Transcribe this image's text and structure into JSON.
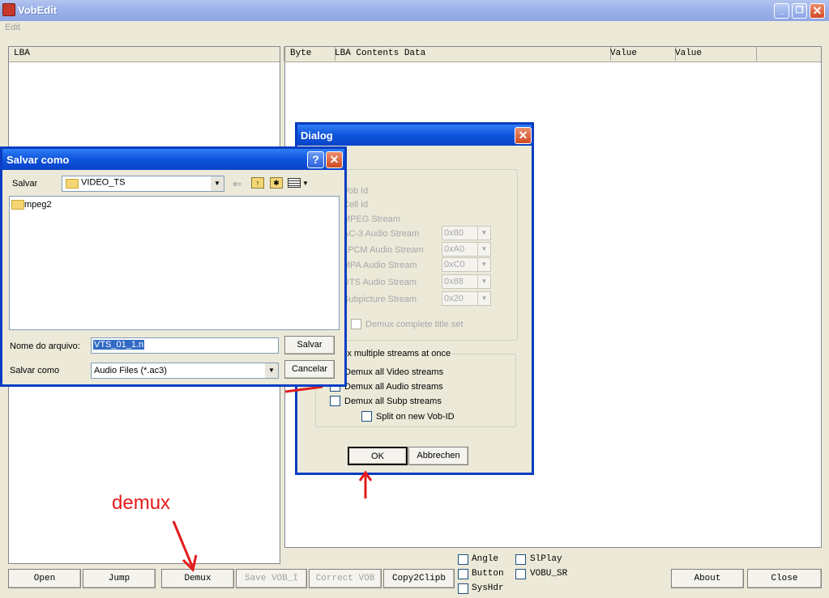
{
  "window": {
    "title": "VobEdit",
    "menu": [
      "Edit"
    ]
  },
  "left_pane": {
    "header": "LBA"
  },
  "right_pane": {
    "headers": [
      "Byte",
      "LBA Contents Data",
      "Value",
      "Value"
    ]
  },
  "bottom_buttons": {
    "open": "Open",
    "jump": "Jump",
    "demux": "Demux",
    "save_vob": "Save VOB_I",
    "correct_vob": "Correct VOB",
    "copy2clipb": "Copy2Clipb",
    "about": "About",
    "close": "Close"
  },
  "checkboxes": {
    "angle": "Angle",
    "button": "Button",
    "syshdr": "SysHdr",
    "slplay": "SlPlay",
    "vobu_sr": "VOBU_SR"
  },
  "annotation": {
    "demux_label": "demux"
  },
  "dialog": {
    "title": "Dialog",
    "fields": {
      "vob_id": "Vob Id",
      "cell_id": "Cell Id",
      "mpeg_stream": "MPEG Stream",
      "ac3": "AC-3 Audio Stream",
      "lpcm": "LPCM Audio Stream",
      "mpa": "MPA Audio Stream",
      "dts": "DTS Audio Stream",
      "subpicture": "Subpicture Stream"
    },
    "values": {
      "ac3": "0x80",
      "lpcm": "0xA0",
      "mpa": "0xC0",
      "dts": "0x88",
      "subpicture": "0x20"
    },
    "demux_title_set": "Demux complete title set",
    "multi_group": "Demux multiple streams at once",
    "demux_video": "Demux all Video streams",
    "demux_audio": "Demux all Audio streams",
    "demux_subp": "Demux all Subp streams",
    "split": "Split on new Vob-ID",
    "ok": "OK",
    "cancel": "Abbrechen"
  },
  "save_dialog": {
    "title": "Salvar como",
    "save_in_label": "Salvar",
    "folder": "VIDEO_TS",
    "files": [
      "mpeg2"
    ],
    "filename_label": "Nome do arquivo:",
    "filename_value": "VTS_01_1.n",
    "type_label": "Salvar como",
    "type_value": "Audio Files (*.ac3)",
    "save_button": "Salvar",
    "cancel_button": "Cancelar"
  }
}
